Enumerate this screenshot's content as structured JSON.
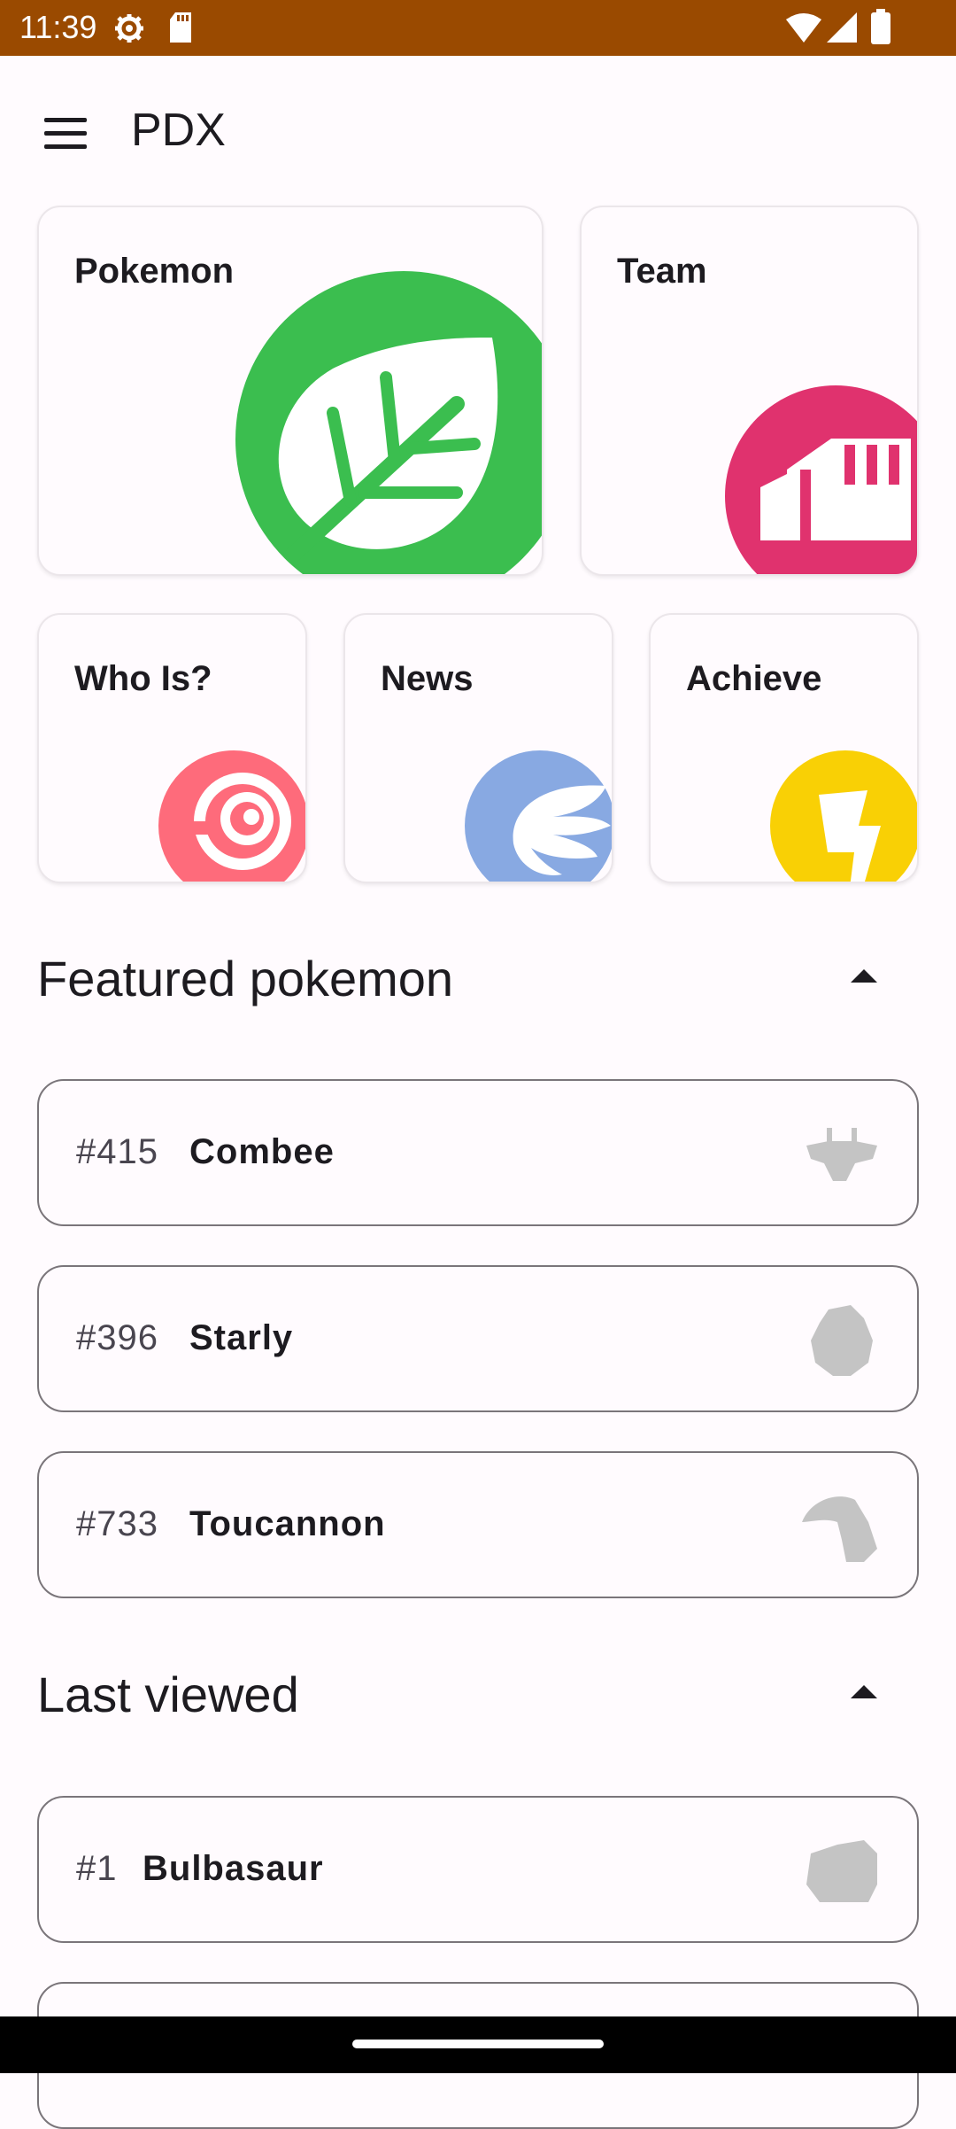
{
  "status_bar": {
    "time": "11:39",
    "left_icons": [
      "settings-icon",
      "sd-card-icon"
    ],
    "right_icons": [
      "wifi-icon",
      "signal-icon",
      "battery-icon"
    ]
  },
  "app_bar": {
    "title": "PDX",
    "menu_icon": "menu-icon"
  },
  "tiles": [
    {
      "label": "Pokemon",
      "icon": "leaf-icon",
      "color": "#3bbe4f"
    },
    {
      "label": "Team",
      "icon": "fist-icon",
      "color": "#e0326e"
    },
    {
      "label": "Who Is?",
      "icon": "spiral-icon",
      "color": "#fe6b7b"
    },
    {
      "label": "News",
      "icon": "wing-icon",
      "color": "#88a9e2"
    },
    {
      "label": "Achieve",
      "icon": "lightning-icon",
      "color": "#f9d005"
    }
  ],
  "featured": {
    "title": "Featured pokemon",
    "items": [
      {
        "number": "#415",
        "name": "Combee"
      },
      {
        "number": "#396",
        "name": "Starly"
      },
      {
        "number": "#733",
        "name": "Toucannon"
      }
    ]
  },
  "last_viewed": {
    "title": "Last viewed",
    "items": [
      {
        "number": "#1",
        "name": "Bulbasaur"
      }
    ]
  },
  "colors": {
    "status_bar": "#9a4a00",
    "background": "#fffbfe",
    "silhouette": "#c4c4c4"
  }
}
